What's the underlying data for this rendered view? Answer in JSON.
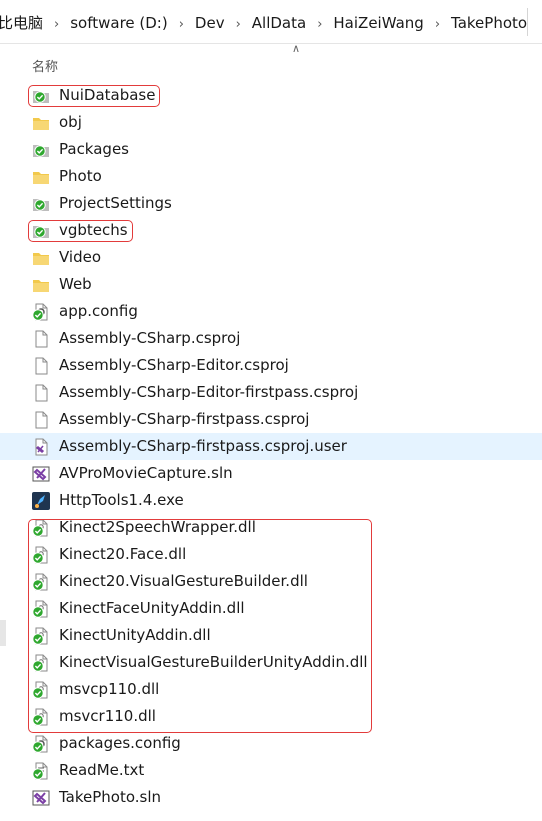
{
  "breadcrumb": [
    "比电脑",
    "software (D:)",
    "Dev",
    "AllData",
    "HaiZeiWang",
    "TakePhoto"
  ],
  "column_header": "名称",
  "files": [
    {
      "name": "NuiDatabase",
      "icon": "folder-synced-icon",
      "kind": "synced-folder"
    },
    {
      "name": "obj",
      "icon": "folder-icon",
      "kind": "folder"
    },
    {
      "name": "Packages",
      "icon": "folder-synced-icon",
      "kind": "synced-folder"
    },
    {
      "name": "Photo",
      "icon": "folder-icon",
      "kind": "folder"
    },
    {
      "name": "ProjectSettings",
      "icon": "folder-synced-icon",
      "kind": "synced-folder"
    },
    {
      "name": "vgbtechs",
      "icon": "folder-synced-icon",
      "kind": "synced-folder"
    },
    {
      "name": "Video",
      "icon": "folder-icon",
      "kind": "folder"
    },
    {
      "name": "Web",
      "icon": "folder-icon",
      "kind": "folder"
    },
    {
      "name": "app.config",
      "icon": "config-file-synced-icon",
      "kind": "synced-config"
    },
    {
      "name": "Assembly-CSharp.csproj",
      "icon": "blank-file-icon",
      "kind": "file"
    },
    {
      "name": "Assembly-CSharp-Editor.csproj",
      "icon": "blank-file-icon",
      "kind": "file"
    },
    {
      "name": "Assembly-CSharp-Editor-firstpass.csproj",
      "icon": "blank-file-icon",
      "kind": "file"
    },
    {
      "name": "Assembly-CSharp-firstpass.csproj",
      "icon": "blank-file-icon",
      "kind": "file"
    },
    {
      "name": "Assembly-CSharp-firstpass.csproj.user",
      "icon": "visual-studio-file-icon",
      "kind": "vsuser",
      "hover": true
    },
    {
      "name": "AVProMovieCapture.sln",
      "icon": "solution-file-icon",
      "kind": "sln"
    },
    {
      "name": "HttpTools1.4.exe",
      "icon": "rocket-app-icon",
      "kind": "exe"
    },
    {
      "name": "Kinect2SpeechWrapper.dll",
      "icon": "dll-file-synced-icon",
      "kind": "synced-dll"
    },
    {
      "name": "Kinect20.Face.dll",
      "icon": "dll-file-synced-icon",
      "kind": "synced-dll"
    },
    {
      "name": "Kinect20.VisualGestureBuilder.dll",
      "icon": "dll-file-synced-icon",
      "kind": "synced-dll"
    },
    {
      "name": "KinectFaceUnityAddin.dll",
      "icon": "dll-file-synced-icon",
      "kind": "synced-dll"
    },
    {
      "name": "KinectUnityAddin.dll",
      "icon": "dll-file-synced-icon",
      "kind": "synced-dll"
    },
    {
      "name": "KinectVisualGestureBuilderUnityAddin.dll",
      "icon": "dll-file-synced-icon",
      "kind": "synced-dll"
    },
    {
      "name": "msvcp110.dll",
      "icon": "dll-file-synced-icon",
      "kind": "synced-dll"
    },
    {
      "name": "msvcr110.dll",
      "icon": "dll-file-synced-icon",
      "kind": "synced-dll"
    },
    {
      "name": "packages.config",
      "icon": "config-file-synced-icon",
      "kind": "synced-config"
    },
    {
      "name": "ReadMe.txt",
      "icon": "text-file-synced-icon",
      "kind": "synced-text"
    },
    {
      "name": "TakePhoto.sln",
      "icon": "solution-file-icon",
      "kind": "sln"
    }
  ],
  "colors": {
    "annotation": "#e23b3b",
    "sync_green": "#2fa82f",
    "folder_yellow": "#f2c94c",
    "hover_blue": "#e5f3ff",
    "vs_purple": "#7b3fa5"
  }
}
